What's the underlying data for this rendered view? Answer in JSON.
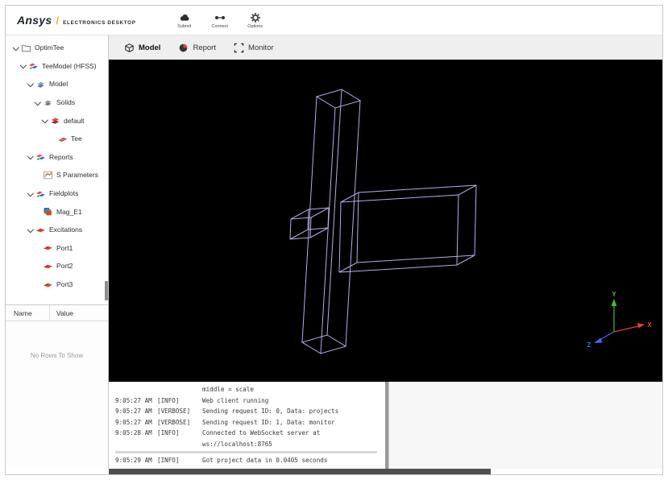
{
  "header": {
    "logo": {
      "brand": "Ansys",
      "slash": "/",
      "product": "ELECTRONICS DESKTOP"
    },
    "toolbar": [
      {
        "label": "Submit",
        "icon": "cloud-icon"
      },
      {
        "label": "Connect",
        "icon": "connect-icon"
      },
      {
        "label": "Options",
        "icon": "gear-icon"
      }
    ]
  },
  "sidebar": {
    "tree": [
      {
        "label": "OptimTee",
        "level": 0,
        "chevron": true,
        "icon": "folder-icon"
      },
      {
        "label": "TeeModel (HFSS)",
        "level": 1,
        "chevron": true,
        "icon": "hfss-icon"
      },
      {
        "label": "Model",
        "level": 2,
        "chevron": true,
        "icon": "model-icon"
      },
      {
        "label": "Solids",
        "level": 3,
        "chevron": true,
        "icon": "solids-icon"
      },
      {
        "label": "default",
        "level": 4,
        "chevron": true,
        "icon": "material-icon"
      },
      {
        "label": "Tee",
        "level": 5,
        "chevron": false,
        "icon": "sheet-icon"
      },
      {
        "label": "Reports",
        "level": 2,
        "chevron": true,
        "icon": "reports-icon"
      },
      {
        "label": "S Parameters",
        "level": 3,
        "chevron": false,
        "icon": "splot-icon"
      },
      {
        "label": "Fieldplots",
        "level": 2,
        "chevron": true,
        "icon": "fieldplots-icon"
      },
      {
        "label": "Mag_E1",
        "level": 3,
        "chevron": false,
        "icon": "fieldplot-icon"
      },
      {
        "label": "Excitations",
        "level": 2,
        "chevron": true,
        "icon": "excitations-icon"
      },
      {
        "label": "Port1",
        "level": 3,
        "chevron": false,
        "icon": "port-icon"
      },
      {
        "label": "Port2",
        "level": 3,
        "chevron": false,
        "icon": "port-icon"
      },
      {
        "label": "Port3",
        "level": 3,
        "chevron": false,
        "icon": "port-icon"
      }
    ],
    "properties": {
      "columns": [
        "Name",
        "Value"
      ],
      "empty_text": "No Rows To Show"
    }
  },
  "main": {
    "tabs": [
      {
        "label": "Model",
        "icon": "model-tab-icon",
        "active": true
      },
      {
        "label": "Report",
        "icon": "report-tab-icon",
        "active": false
      },
      {
        "label": "Monitor",
        "icon": "monitor-tab-icon",
        "active": false
      }
    ],
    "viewport": {
      "background": "#000000",
      "wireframe_color": "#b3aee6",
      "wireframe_paths": [
        "M258 46L289 37L312 51L281 60Z",
        "M240 351L271 342L294 356L263 365Z",
        "M258 46L240 351",
        "M289 37L271 342",
        "M312 51L294 356",
        "M281 60L263 365",
        "M288 177L310 165L456 156L434 168Z",
        "M286 264L308 252L454 243L432 255Z",
        "M288 177L286 264",
        "M310 165L308 252",
        "M434 168L432 255",
        "M456 156L454 243",
        "M251 196L273 184L248 186L226 198Z",
        "M250 221L272 209L247 211L225 223Z",
        "M251 196L250 221",
        "M273 184L272 209",
        "M248 186L247 211",
        "M226 198L225 223"
      ],
      "axes": {
        "x": {
          "label": "X",
          "color": "#e04040"
        },
        "y": {
          "label": "Y",
          "color": "#3fbf3f"
        },
        "z": {
          "label": "Z",
          "color": "#4b63f2"
        }
      }
    }
  },
  "console": {
    "lines": [
      {
        "time": "",
        "level": "",
        "message": "middle = scale"
      },
      {
        "time": "9:05:27 AM",
        "level": "[INFO]",
        "message": "Web client running"
      },
      {
        "time": "9:05:27 AM",
        "level": "[VERBOSE]",
        "message": "Sending request ID: 0, Data: projects"
      },
      {
        "time": "9:05:27 AM",
        "level": "[VERBOSE]",
        "message": "Sending request ID: 1, Data: monitor"
      },
      {
        "time": "9:05:28 AM",
        "level": "[INFO]",
        "message": "Connected to WebSocket server at"
      },
      {
        "time": "",
        "level": "",
        "message": "ws://localhost:8765"
      },
      {
        "time": "9:05:29 AM",
        "level": "[INFO]",
        "message": "Got project data in 0.0405 seconds"
      }
    ]
  }
}
